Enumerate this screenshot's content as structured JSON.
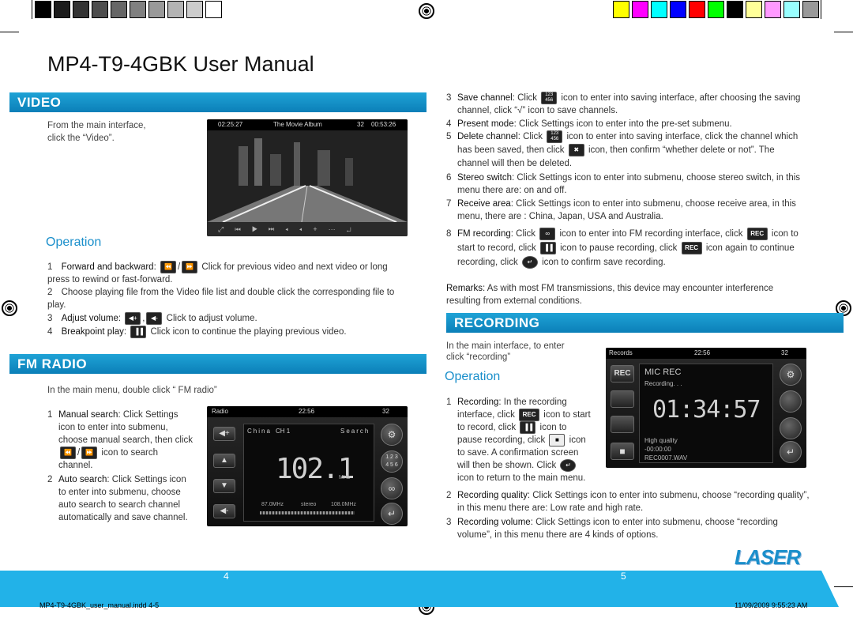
{
  "doc": {
    "title": "MP4-T9-4GBK User Manual",
    "page_left": "4",
    "page_right": "5",
    "footer_file": "MP4-T9-4GBK_user_manual.indd   4-5",
    "footer_date": "11/09/2009   9:55:23 AM",
    "logo_text": "LASER"
  },
  "colors": {
    "accent": "#1a8fcb",
    "header_bar": "#0b7fb8",
    "bleed_bar": "#22b2e8",
    "swatches_gray": [
      "#000000",
      "#1c1c1c",
      "#333333",
      "#4d4d4d",
      "#666666",
      "#808080",
      "#999999",
      "#b3b3b3",
      "#cccccc",
      "#ffffff"
    ],
    "swatches_color": [
      "#ffff00",
      "#ff00ff",
      "#00ffff",
      "#0000ff",
      "#ff0000",
      "#00ff00",
      "#000000",
      "#ffff99",
      "#ff99ff",
      "#99ffff",
      "#999999"
    ]
  },
  "video": {
    "heading": "VIDEO",
    "intro": "From the main interface, click the “Video”.",
    "screen": {
      "time_left": "02:25:27",
      "album": "The Movie Album",
      "track": "32",
      "time_right": "00:53:26"
    },
    "operation": "Operation",
    "items": [
      {
        "num": "1",
        "term": "Forward and backward",
        "text_a": ":",
        "sep": "/",
        "text_b": "Click for previous video and next video or long press to rewind or fast-forward."
      },
      {
        "num": "2",
        "text": "Choose playing file from the Video file list and double click the corresponding file to play."
      },
      {
        "num": "3",
        "term": "Adjust volume",
        "text_a": ":",
        "sep": ",",
        "text_b": "Click  to adjust volume."
      },
      {
        "num": "4",
        "term": "Breakpoint play",
        "text_a": ":",
        "text_b": "Click  icon to continue the playing previous video."
      }
    ]
  },
  "fm": {
    "heading": "FM RADIO",
    "intro": "In the main menu, double click “ FM radio”",
    "items": [
      {
        "num": "1",
        "term": "Manual search",
        "text": ": Click Settings icon to enter into submenu, choose manual search, then click",
        "sep": "/",
        "text_b": "icon to search channel."
      },
      {
        "num": "2",
        "term": "Auto search",
        "text": ": Click Settings icon to enter into submenu, choose auto search to search channel automatically and save channel."
      }
    ],
    "screen": {
      "title": "Radio",
      "time": "22:56",
      "track": "32",
      "station": "China",
      "ch": "CH 1",
      "search": "Search",
      "freq": "102.1",
      "unit": "MHz",
      "low": "87.0MHz",
      "mode": "stereo",
      "high": "108.0MHz",
      "keypad": "1 2 3\n4 5 6"
    },
    "right_items": [
      {
        "num": "3",
        "term": "Save channel",
        "text": ": Click",
        "text_b": "icon to enter into saving interface, after choosing the saving channel, click “√” icon to save channels."
      },
      {
        "num": "4",
        "term": "Present mode",
        "text": ": Click Settings icon to enter into the pre-set submenu."
      },
      {
        "num": "5",
        "term": "Delete channel",
        "text": ": Click",
        "text_b": "icon to enter into saving interface, click the channel which has been saved, then click",
        "text_c": "icon, then confirm “whether delete or not”. The channel will then be deleted."
      },
      {
        "num": "6",
        "term": "Stereo switch",
        "text": ": Click Settings icon to enter into submenu, choose stereo switch, in this menu there are: on and off."
      },
      {
        "num": "7",
        "term": "Receive area",
        "text": ": Click Settings icon to enter into submenu, choose receive area, in this menu, there are : China, Japan, USA and Australia."
      },
      {
        "num": "8",
        "term": "FM recording",
        "text": ": Click",
        "text_b": "icon to enter into FM recording interface, click",
        "text_c": "icon to start to record, click",
        "text_d": "icon to pause recording, click",
        "text_e": "icon again to continue recording, click",
        "text_f": "icon to confirm save recording."
      }
    ],
    "remarks_term": "Remarks",
    "remarks": ": As with most FM transmissions, this device may encounter interference resulting from external conditions."
  },
  "recording": {
    "heading": "RECORDING",
    "intro": "In the main interface, to enter click “recording”",
    "operation": "Operation",
    "screen": {
      "title": "Records",
      "time": "22:56",
      "track": "32",
      "mode": "MIC REC",
      "status": "Recording. . .",
      "clock": "01:34:57",
      "quality": "High quality",
      "elapsed": "-00:00:00",
      "file": "REC0007.WAV",
      "rec_label": "REC"
    },
    "items": [
      {
        "num": "1",
        "term": "Recording",
        "text": ": In the recording interface, click",
        "text_b": "icon to start to record, click",
        "text_c": "icon to pause recording, click",
        "text_d": "icon to save. A confirmation screen will then be shown. Click",
        "text_e": "icon to return to the main menu."
      },
      {
        "num": "2",
        "term": "Recording quality",
        "text": ": Click Settings icon to enter into submenu, choose “recording quality”, in this menu there are: Low rate and high rate."
      },
      {
        "num": "3",
        "term": "Recording volume",
        "text": ": Click Settings icon to enter into submenu, choose “recording volume”, in this menu there are 4 kinds of options."
      }
    ]
  },
  "icons": {
    "rew": "⏪",
    "fwd": "⏩",
    "vol_down": "◀-",
    "vol_up": "◀+",
    "bp": "▐▐",
    "save": "123\n456",
    "trash": "✖",
    "tape": "∞",
    "rec": "REC",
    "pause": "▐▐",
    "stop": "■",
    "enter": "↵"
  }
}
